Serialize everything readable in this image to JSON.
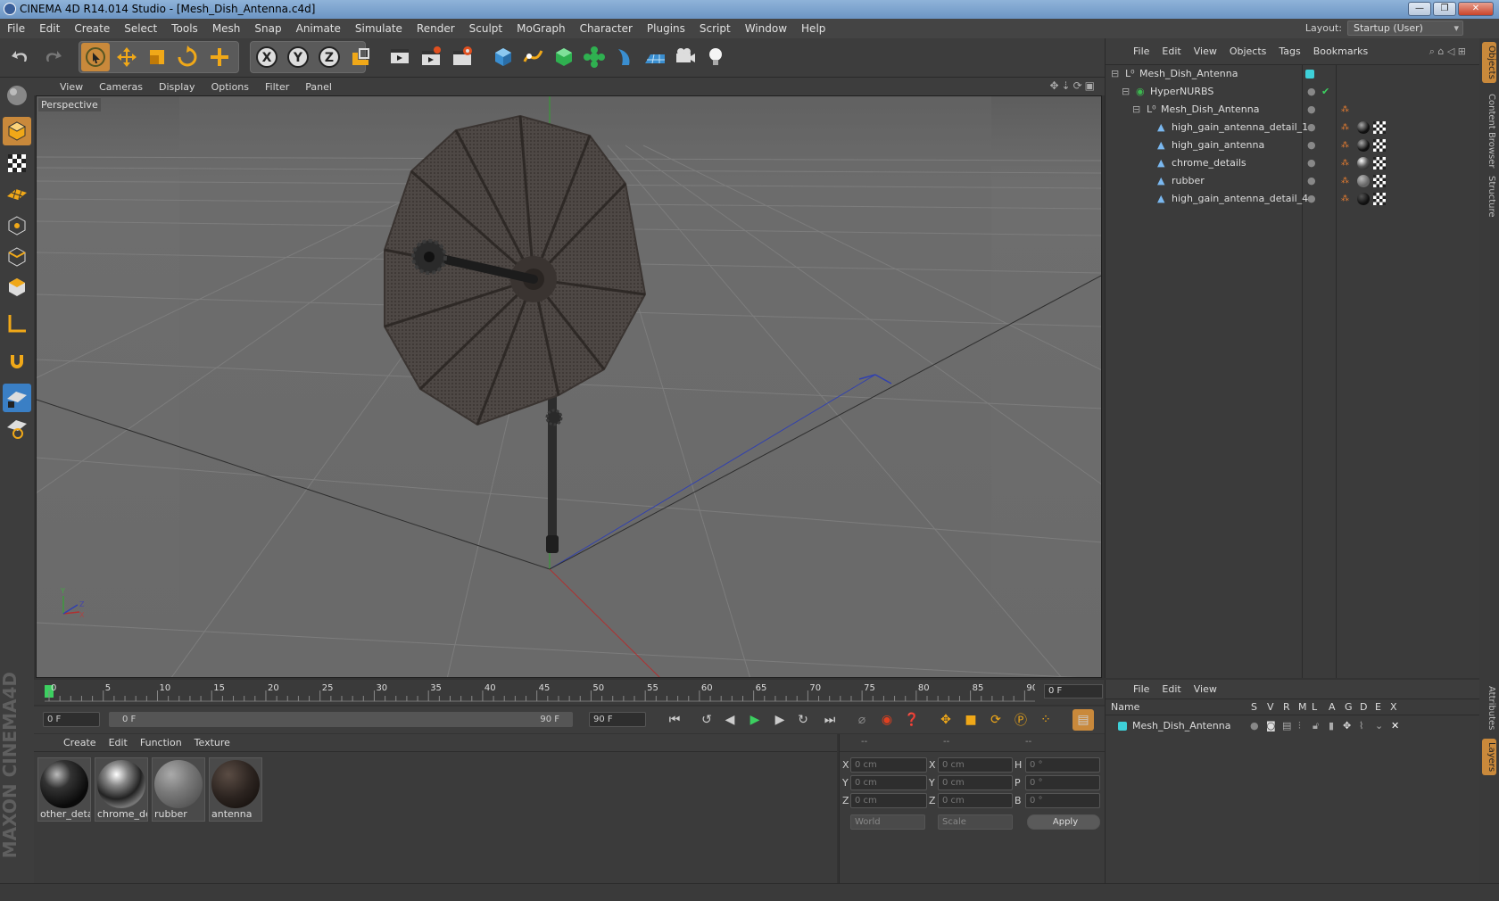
{
  "window": {
    "title": "CINEMA 4D R14.014 Studio - [Mesh_Dish_Antenna.c4d]",
    "buttons": [
      "—",
      "❐",
      "✕"
    ]
  },
  "menubar": [
    "File",
    "Edit",
    "Create",
    "Select",
    "Tools",
    "Mesh",
    "Snap",
    "Animate",
    "Simulate",
    "Render",
    "Sculpt",
    "MoGraph",
    "Character",
    "Plugins",
    "Script",
    "Window",
    "Help"
  ],
  "layout": {
    "label": "Layout:",
    "value": "Startup (User)"
  },
  "toolbar": {
    "undo": "undo-icon",
    "redo": "redo-icon",
    "axes": [
      "X",
      "Y",
      "Z"
    ]
  },
  "viewport": {
    "menu": [
      "View",
      "Cameras",
      "Display",
      "Options",
      "Filter",
      "Panel"
    ],
    "label": "Perspective",
    "axis_labels": [
      "Y",
      "Z",
      "X"
    ]
  },
  "timeline": {
    "ticks": [
      "0",
      "5",
      "10",
      "15",
      "20",
      "25",
      "30",
      "35",
      "40",
      "45",
      "50",
      "55",
      "60",
      "65",
      "70",
      "75",
      "80",
      "85",
      "90"
    ],
    "current_frame": "0 F",
    "start": "0 F",
    "range_start": "0 F",
    "range_end": "90 F",
    "end": "90 F"
  },
  "materials": {
    "menu": [
      "Create",
      "Edit",
      "Function",
      "Texture"
    ],
    "items": [
      {
        "label": "other_deta"
      },
      {
        "label": "chrome_de"
      },
      {
        "label": "rubber"
      },
      {
        "label": "antenna"
      }
    ]
  },
  "coords": {
    "headers": [
      "--",
      "--",
      "--"
    ],
    "rows": [
      {
        "a": "X",
        "av": "0 cm",
        "b": "X",
        "bv": "0 cm",
        "c": "H",
        "cv": "0 °"
      },
      {
        "a": "Y",
        "av": "0 cm",
        "b": "Y",
        "bv": "0 cm",
        "c": "P",
        "cv": "0 °"
      },
      {
        "a": "Z",
        "av": "0 cm",
        "b": "Z",
        "bv": "0 cm",
        "c": "B",
        "cv": "0 °"
      }
    ],
    "mode": "World",
    "scale": "Scale",
    "apply": "Apply"
  },
  "objects": {
    "menu": [
      "File",
      "Edit",
      "View",
      "Objects",
      "Tags",
      "Bookmarks"
    ],
    "tree": [
      {
        "name": "Mesh_Dish_Antenna",
        "indent": 0
      },
      {
        "name": "HyperNURBS",
        "indent": 1
      },
      {
        "name": "Mesh_Dish_Antenna",
        "indent": 2
      },
      {
        "name": "high_gain_antenna_detail_1",
        "indent": 3
      },
      {
        "name": "high_gain_antenna",
        "indent": 3
      },
      {
        "name": "chrome_details",
        "indent": 3
      },
      {
        "name": "rubber",
        "indent": 3
      },
      {
        "name": "high_gain_antenna_detail_4",
        "indent": 3
      }
    ]
  },
  "layers": {
    "menu": [
      "File",
      "Edit",
      "View"
    ],
    "columns": [
      "Name",
      "S",
      "V",
      "R",
      "M",
      "L",
      "A",
      "G",
      "D",
      "E",
      "X"
    ],
    "rows": [
      {
        "name": "Mesh_Dish_Antenna"
      }
    ]
  },
  "side_tabs": [
    "Objects",
    "Content Browser",
    "Structure",
    "Attributes",
    "Layers"
  ],
  "branding": "MAXON CINEMA4D"
}
